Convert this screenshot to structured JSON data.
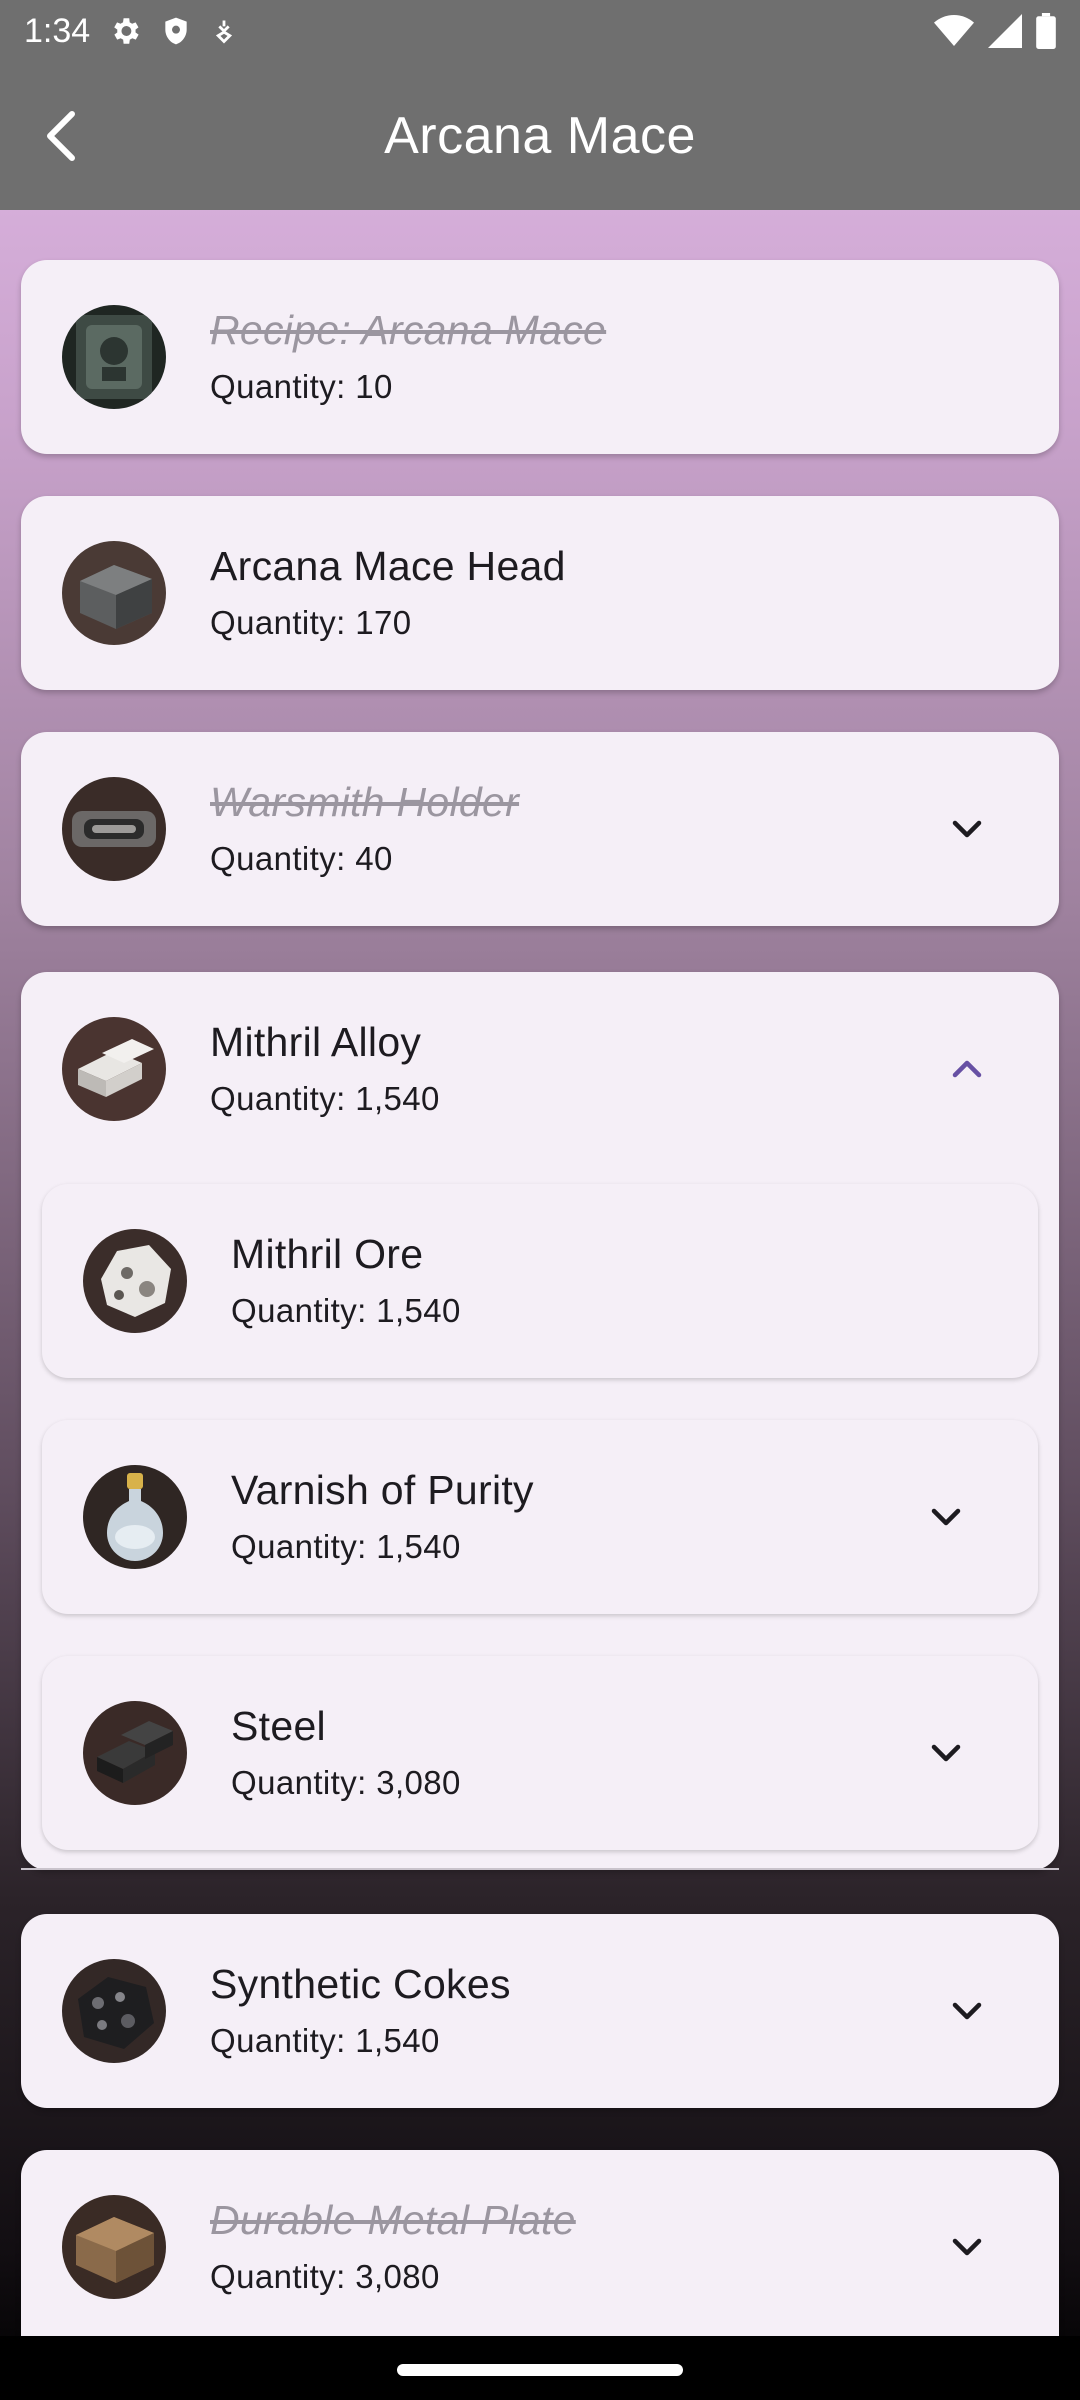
{
  "status_bar": {
    "time": "1:34",
    "icons": [
      "gear-icon",
      "shield-icon",
      "location-icon",
      "wifi-icon",
      "signal-icon",
      "battery-icon"
    ]
  },
  "app_bar": {
    "title": "Arcana Mace",
    "back_icon": "back-arrow-icon"
  },
  "items": [
    {
      "name": "Recipe: Arcana Mace",
      "quantity": "Quantity: 10",
      "completed": true,
      "expandable": false
    },
    {
      "name": "Arcana Mace Head",
      "quantity": "Quantity: 170",
      "completed": false,
      "expandable": false
    },
    {
      "name": "Warsmith Holder",
      "quantity": "Quantity: 40",
      "completed": true,
      "expandable": true,
      "expanded": false
    },
    {
      "name": "Mithril Alloy",
      "quantity": "Quantity: 1,540",
      "completed": false,
      "expandable": true,
      "expanded": true,
      "children": [
        {
          "name": "Mithril Ore",
          "quantity": "Quantity: 1,540",
          "expandable": false
        },
        {
          "name": "Varnish of Purity",
          "quantity": "Quantity: 1,540",
          "expandable": true
        },
        {
          "name": "Steel",
          "quantity": "Quantity: 3,080",
          "expandable": true
        }
      ]
    },
    {
      "name": "Synthetic Cokes",
      "quantity": "Quantity: 1,540",
      "completed": false,
      "expandable": true,
      "expanded": false
    },
    {
      "name": "Durable Metal Plate",
      "quantity": "Quantity: 3,080",
      "completed": true,
      "expandable": true,
      "expanded": false
    }
  ],
  "colors": {
    "bar": "#6f6f6f",
    "card": "#f5eff7",
    "accent": "#6750a4",
    "text": "#1d1b20",
    "completed_text": "#9b96a0"
  }
}
